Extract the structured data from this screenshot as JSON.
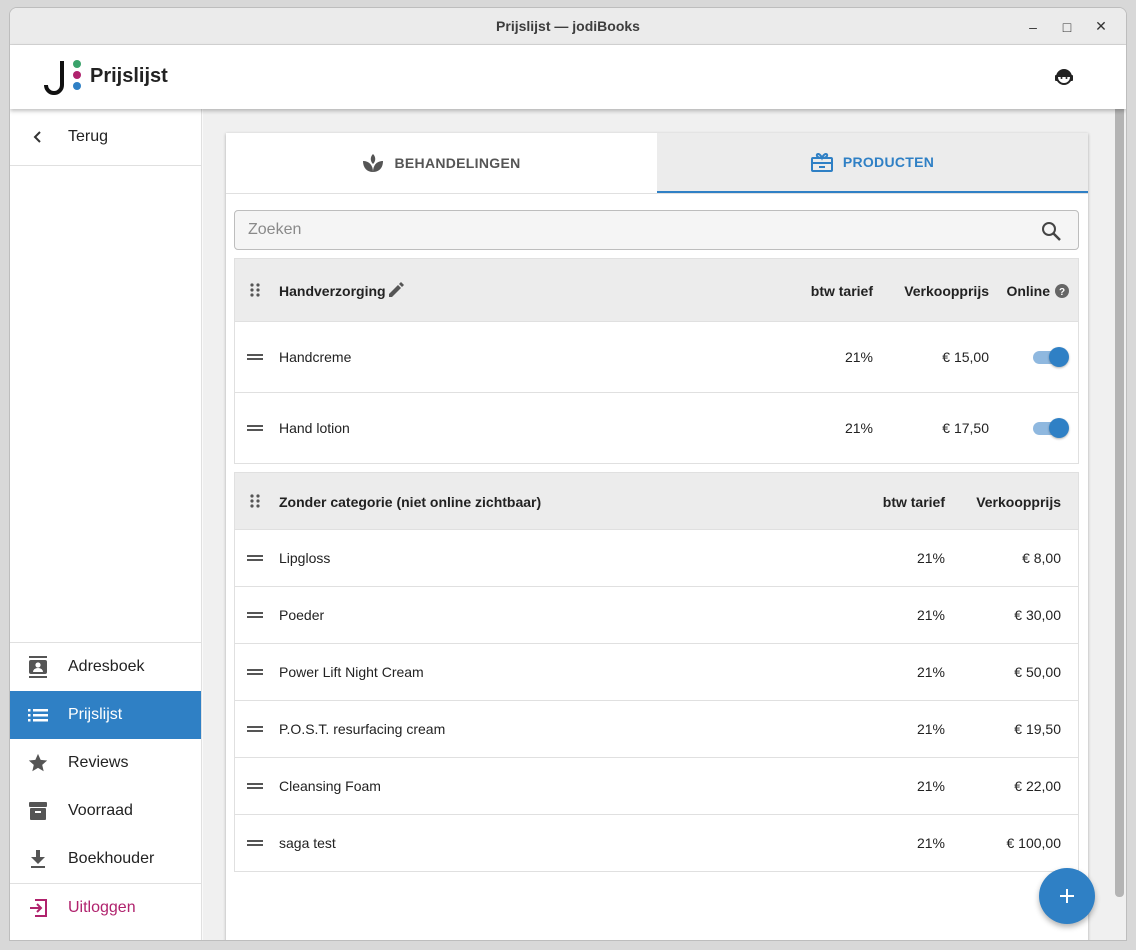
{
  "window": {
    "title": "Prijslijst — jodiBooks"
  },
  "appbar": {
    "title": "Prijslijst"
  },
  "colors": {
    "accent": "#2f80c5",
    "logout": "#b0226d",
    "logo_dots": [
      "#3aa36b",
      "#b0226d",
      "#2f80c5"
    ]
  },
  "sidebar": {
    "back_label": "Terug",
    "items": [
      {
        "label": "Adresboek",
        "icon": "contact-book-icon"
      },
      {
        "label": "Prijslijst",
        "icon": "list-icon",
        "active": true
      },
      {
        "label": "Reviews",
        "icon": "star-icon"
      },
      {
        "label": "Voorraad",
        "icon": "archive-box-icon"
      },
      {
        "label": "Boekhouder",
        "icon": "download-icon"
      }
    ],
    "logout_label": "Uitloggen"
  },
  "tabs": [
    {
      "label": "BEHANDELINGEN",
      "icon": "spa-icon"
    },
    {
      "label": "PRODUCTEN",
      "icon": "gift-box-icon",
      "active": true
    }
  ],
  "search": {
    "placeholder": "Zoeken",
    "value": ""
  },
  "groups": [
    {
      "title": "Handverzorging",
      "columns": {
        "vat": "btw tarief",
        "price": "Verkoopprijs",
        "online": "Online"
      },
      "rows": [
        {
          "name": "Handcreme",
          "vat": "21%",
          "price": "€ 15,00",
          "online": true
        },
        {
          "name": "Hand lotion",
          "vat": "21%",
          "price": "€ 17,50",
          "online": true
        }
      ]
    },
    {
      "title": "Zonder categorie (niet online zichtbaar)",
      "columns": {
        "vat": "btw tarief",
        "price": "Verkoopprijs"
      },
      "rows": [
        {
          "name": "Lipgloss",
          "vat": "21%",
          "price": "€ 8,00"
        },
        {
          "name": "Poeder",
          "vat": "21%",
          "price": "€ 30,00"
        },
        {
          "name": "Power Lift Night Cream",
          "vat": "21%",
          "price": "€ 50,00"
        },
        {
          "name": "P.O.S.T. resurfacing cream",
          "vat": "21%",
          "price": "€ 19,50"
        },
        {
          "name": "Cleansing Foam",
          "vat": "21%",
          "price": "€ 22,00"
        },
        {
          "name": "saga test",
          "vat": "21%",
          "price": "€ 100,00"
        }
      ]
    }
  ]
}
